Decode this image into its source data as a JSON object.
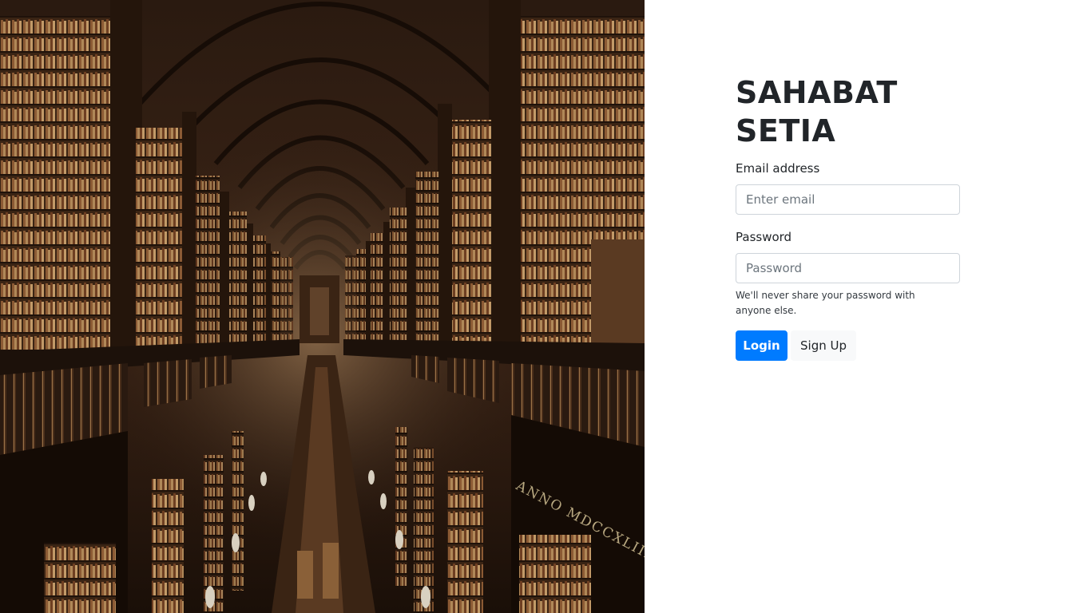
{
  "brand": {
    "line1": "SAHABAT",
    "line2": "SETIA"
  },
  "login_form": {
    "email_label": "Email address",
    "email_placeholder": "Enter email",
    "email_value": "",
    "password_label": "Password",
    "password_placeholder": "Password",
    "password_value": "",
    "help_text": "We'll never share your password with anyone else.",
    "login_button": "Login",
    "signup_button": "Sign Up"
  },
  "hero": {
    "subject": "library-hall-photo",
    "inscription": "ANNO MDCCXLIII."
  },
  "colors": {
    "primary": "#007bff",
    "text": "#212529",
    "muted": "#6c757d",
    "input_border": "#ced4da",
    "light_button": "#f8f9fa"
  }
}
